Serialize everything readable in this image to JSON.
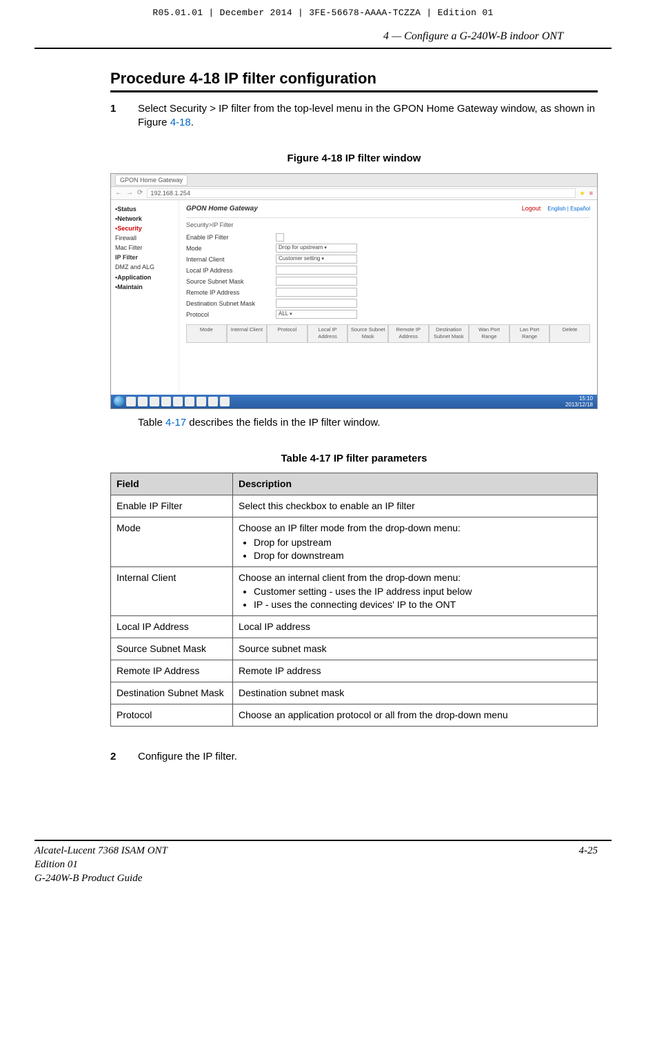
{
  "doc_header": "R05.01.01 | December 2014 | 3FE-56678-AAAA-TCZZA | Edition 01",
  "running_head": "4 —  Configure a G-240W-B indoor ONT",
  "procedure_title": "Procedure 4-18  IP filter configuration",
  "step1": {
    "num": "1",
    "text_pre": "Select Security > IP filter from the top-level menu in the GPON Home Gateway window, as shown in Figure ",
    "xref": "4-18",
    "text_post": "."
  },
  "figure_caption": "Figure 4-18  IP filter window",
  "screenshot": {
    "tab_title": "GPON Home Gateway",
    "url": "192.168.1.254",
    "brand": "GPON Home Gateway",
    "logout": "Logout",
    "lang1": "English",
    "lang2": "Español",
    "breadcrumb": "Security>IP Filter",
    "nav": {
      "status": "Status",
      "network": "Network",
      "security": "Security",
      "firewall": "Firewall",
      "mac_filter": "Mac Filter",
      "ip_filter": "IP Filter",
      "dmz_alg": "DMZ and ALG",
      "application": "Application",
      "maintain": "Maintain"
    },
    "form": {
      "enable": "Enable IP Filter",
      "mode": "Mode",
      "mode_val": "Drop for upstream",
      "internal": "Internal Client",
      "internal_val": "Customer setting",
      "local_ip": "Local IP Address",
      "src_mask": "Source Subnet Mask",
      "remote_ip": "Remote IP Address",
      "dst_mask": "Destination Subnet Mask",
      "protocol": "Protocol",
      "protocol_val": "ALL"
    },
    "table_headers": [
      "Mode",
      "Internal Client",
      "Protocol",
      "Local IP Address",
      "Source Subnet Mask",
      "Remote IP Address",
      "Destination Subnet Mask",
      "Wan Port Range",
      "Lan Port Range",
      "Delete"
    ],
    "time": "15:10",
    "date": "2013/12/18"
  },
  "after_fig_pre": "Table ",
  "after_fig_xref": "4-17",
  "after_fig_post": " describes the fields in the IP filter window.",
  "table_caption": "Table 4-17 IP filter parameters",
  "table": {
    "head_field": "Field",
    "head_desc": "Description",
    "rows": [
      {
        "field": "Enable IP Filter",
        "desc": "Select this checkbox to enable an IP filter"
      },
      {
        "field": "Mode",
        "desc": "Choose an IP filter mode from the drop-down menu:",
        "bullets": [
          "Drop for upstream",
          "Drop for downstream"
        ]
      },
      {
        "field": "Internal Client",
        "desc": "Choose an internal client from the drop-down menu:",
        "bullets": [
          "Customer setting - uses the IP address input below",
          "IP - uses the connecting devices' IP to the ONT"
        ]
      },
      {
        "field": "Local IP Address",
        "desc": "Local IP address"
      },
      {
        "field": "Source Subnet Mask",
        "desc": "Source subnet mask"
      },
      {
        "field": "Remote IP Address",
        "desc": "Remote IP address"
      },
      {
        "field": "Destination Subnet Mask",
        "desc": "Destination subnet mask"
      },
      {
        "field": "Protocol",
        "desc": "Choose an application protocol or all from the drop-down menu"
      }
    ]
  },
  "step2": {
    "num": "2",
    "text": "Configure the IP filter."
  },
  "footer": {
    "line1": "Alcatel-Lucent 7368 ISAM ONT",
    "line2": "Edition 01",
    "line3": "G-240W-B Product Guide",
    "page": "4-25"
  }
}
